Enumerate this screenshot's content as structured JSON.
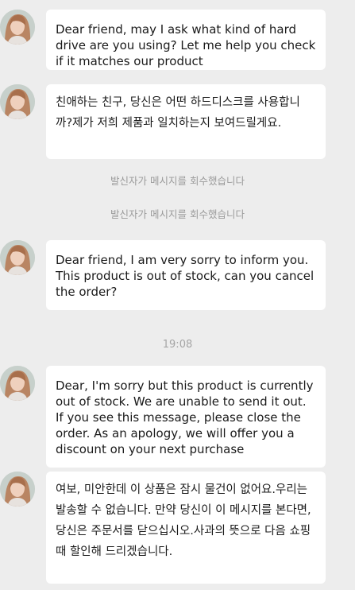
{
  "messages": [
    {
      "text": "Dear friend, may I ask what kind of hard drive are you using? Let me help you check if it matches our product"
    },
    {
      "text": "친애하는 친구, 당신은 어떤 하드디스크를 사용합니까?제가 저희 제품과 일치하는지 보여드릴게요."
    },
    {
      "text": "Dear friend, I am very sorry to inform you. This product is out of stock, can you cancel the order?"
    },
    {
      "text": "Dear, I'm sorry but this product is currently out of stock. We are unable to send it out. If you see this message, please close the order. As an apology, we will offer you a discount on your next purchase"
    },
    {
      "text": "여보, 미안한데 이 상품은 잠시 물건이 없어요.우리는 발송할 수 없습니다. 만약 당신이 이 메시지를 본다면, 당신은 주문서를 닫으십시오.사과의 뜻으로 다음 쇼핑 때 할인해 드리겠습니다."
    }
  ],
  "notices": [
    "발신자가 메시지를 회수했습니다",
    "발신자가 메시지를 회수했습니다"
  ],
  "timestamp": "19:08",
  "colors": {
    "background": "#ededed",
    "bubble": "#ffffff",
    "text": "#1a1a1a",
    "system_text": "#9b9b9b"
  },
  "avatar_icon": "user-avatar-icon"
}
